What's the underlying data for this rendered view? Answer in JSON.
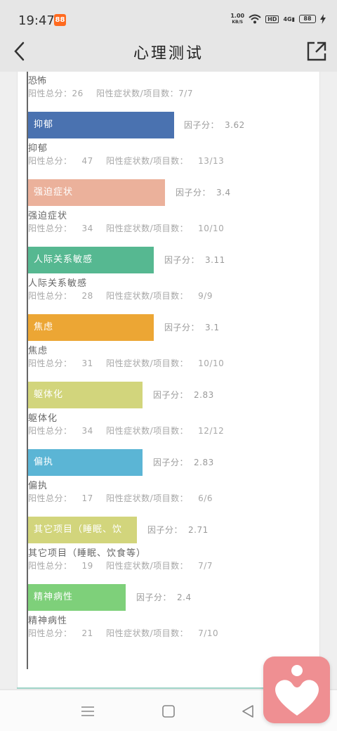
{
  "status": {
    "time": "19:47",
    "app_badge": "88",
    "net_speed_value": "1.00",
    "net_speed_unit": "KB/S",
    "hd": "HD",
    "signal": "4G",
    "battery": "88"
  },
  "nav": {
    "title": "心理测试"
  },
  "report": {
    "fragment": {
      "name": "恐怖",
      "total_label": "阳性总分：",
      "total": "26",
      "ratio_label": "阳性症状数/项目数：",
      "ratio": "7/7"
    },
    "items": [
      {
        "bar_label": "抑郁",
        "factor_label": "因子分：",
        "factor": "3.62",
        "name": "抑郁",
        "total_label": "阳性总分：",
        "total": "47",
        "ratio_label": "阳性症状数/项目数：",
        "ratio": "13/13",
        "color": "#4a72b0"
      },
      {
        "bar_label": "强迫症状",
        "factor_label": "因子分：",
        "factor": "3.4",
        "name": "强迫症状",
        "total_label": "阳性总分：",
        "total": "34",
        "ratio_label": "阳性症状数/项目数：",
        "ratio": "10/10",
        "color": "#ebb19b"
      },
      {
        "bar_label": "人际关系敏感",
        "factor_label": "因子分：",
        "factor": "3.11",
        "name": "人际关系敏感",
        "total_label": "阳性总分：",
        "total": "28",
        "ratio_label": "阳性症状数/项目数：",
        "ratio": "9/9",
        "color": "#56b891"
      },
      {
        "bar_label": "焦虑",
        "factor_label": "因子分：",
        "factor": "3.1",
        "name": "焦虑",
        "total_label": "阳性总分：",
        "total": "31",
        "ratio_label": "阳性症状数/项目数：",
        "ratio": "10/10",
        "color": "#eca634"
      },
      {
        "bar_label": "躯体化",
        "factor_label": "因子分：",
        "factor": "2.83",
        "name": "躯体化",
        "total_label": "阳性总分：",
        "total": "34",
        "ratio_label": "阳性症状数/项目数：",
        "ratio": "12/12",
        "color": "#d2d57c"
      },
      {
        "bar_label": "偏执",
        "factor_label": "因子分：",
        "factor": "2.83",
        "name": "偏执",
        "total_label": "阳性总分：",
        "total": "17",
        "ratio_label": "阳性症状数/项目数：",
        "ratio": "6/6",
        "color": "#5bb5d5"
      },
      {
        "bar_label": "其它项目（睡眠、饮",
        "factor_label": "因子分：",
        "factor": "2.71",
        "name": "其它项目（睡眠、饮食等）",
        "total_label": "阳性总分：",
        "total": "19",
        "ratio_label": "阳性症状数/项目数：",
        "ratio": "7/7",
        "color": "#d2d57c"
      },
      {
        "bar_label": "精神病性",
        "factor_label": "因子分：",
        "factor": "2.4",
        "name": "精神病性",
        "total_label": "阳性总分：",
        "total": "21",
        "ratio_label": "阳性症状数/项目数：",
        "ratio": "7/10",
        "color": "#7ed07a"
      }
    ]
  },
  "icons": {
    "back": "chevron-left-icon",
    "share": "share-icon",
    "menu": "menu-icon",
    "home": "home-square-icon",
    "back_nav": "triangle-back-icon",
    "fab": "heart-person-icon"
  },
  "colors": {
    "fab": "#ef8f92",
    "axis": "#666666",
    "accent_line": "#9fd4c8"
  }
}
